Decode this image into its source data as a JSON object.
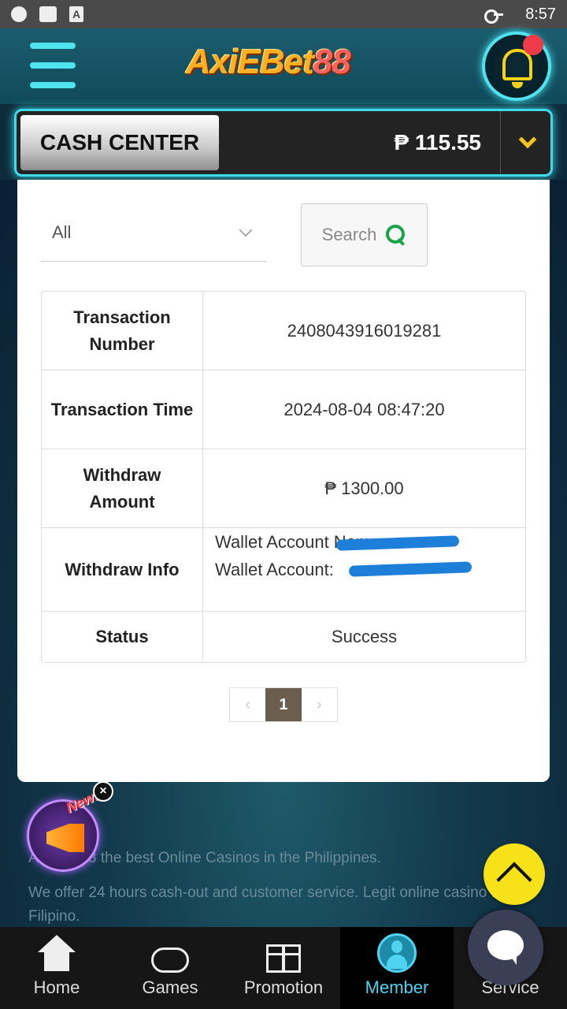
{
  "status_bar": {
    "time": "8:57"
  },
  "header": {
    "logo_text": "AxiEBet88"
  },
  "cash_center": {
    "label": "CASH CENTER",
    "balance": "₱ 115.55"
  },
  "filter": {
    "selected": "All",
    "search_label": "Search"
  },
  "details": [
    {
      "label": "Transaction Number",
      "value": "2408043916019281"
    },
    {
      "label": "Transaction Time",
      "value": "2024-08-04 08:47:20"
    },
    {
      "label": "Withdraw Amount",
      "value": "₱ 1300.00"
    },
    {
      "label": "Withdraw Info",
      "value_line1": "Wallet Account Name:",
      "value_line2": "Wallet Account:"
    },
    {
      "label": "Status",
      "value": "Success"
    }
  ],
  "pagination": {
    "prev": "‹",
    "current": "1",
    "next": "›"
  },
  "footer": {
    "line1": "AxieBet88 the best Online Casinos in the Philippines.",
    "line2": "We offer 24 hours cash-out and customer service. Legit online casino for Filipino."
  },
  "promo": {
    "badge": "New!"
  },
  "nav": [
    {
      "label": "Home",
      "icon": "home-icon"
    },
    {
      "label": "Games",
      "icon": "gamepad-icon"
    },
    {
      "label": "Promotion",
      "icon": "gift-icon"
    },
    {
      "label": "Member",
      "icon": "member-icon"
    },
    {
      "label": "Service",
      "icon": "chat-icon"
    }
  ],
  "colors": {
    "accent": "#4fe3ee",
    "balance_chevron": "#f5c31c",
    "active_page": "#6b5e4f",
    "scroll_top": "#f7e21a"
  }
}
